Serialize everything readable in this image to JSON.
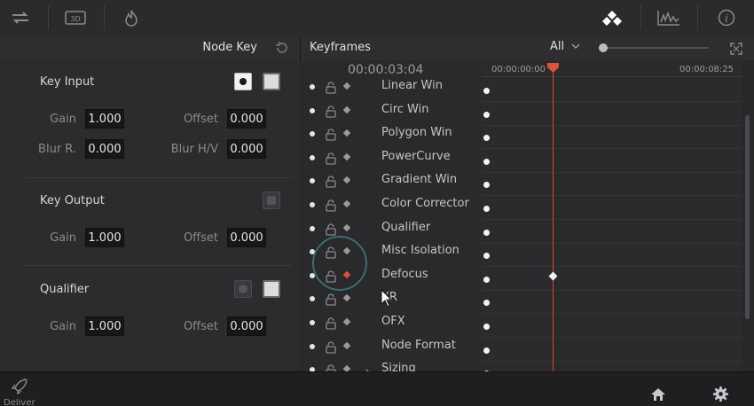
{
  "node_key": {
    "title": "Node Key",
    "key_input": {
      "title": "Key Input",
      "gain_label": "Gain",
      "gain": "1.000",
      "offset_label": "Offset",
      "offset": "0.000",
      "blur_r_label": "Blur R.",
      "blur_r": "0.000",
      "blur_hv_label": "Blur H/V",
      "blur_hv": "0.000"
    },
    "key_output": {
      "title": "Key Output",
      "gain_label": "Gain",
      "gain": "1.000",
      "offset_label": "Offset",
      "offset": "0.000"
    },
    "qualifier": {
      "title": "Qualifier",
      "gain_label": "Gain",
      "gain": "1.000",
      "offset_label": "Offset",
      "offset": "0.000"
    }
  },
  "keyframes": {
    "title": "Keyframes",
    "filter": "All",
    "timecode": "00:00:03:04",
    "ruler_start": "00:00:00:00",
    "ruler_end": "00:00:08:25",
    "rows": [
      {
        "name": "Linear Win"
      },
      {
        "name": "Circ Win"
      },
      {
        "name": "Polygon Win"
      },
      {
        "name": "PowerCurve"
      },
      {
        "name": "Gradient Win"
      },
      {
        "name": "Color Corrector"
      },
      {
        "name": "Qualifier"
      },
      {
        "name": "Misc Isolation"
      },
      {
        "name": "Defocus"
      },
      {
        "name": "XR"
      },
      {
        "name": "OFX"
      },
      {
        "name": "Node Format"
      },
      {
        "name": "Sizing"
      }
    ]
  },
  "bottom": {
    "deliver_label": "Deliver"
  },
  "colors": {
    "accent": "#e0503a",
    "playhead": "#d9442e"
  }
}
